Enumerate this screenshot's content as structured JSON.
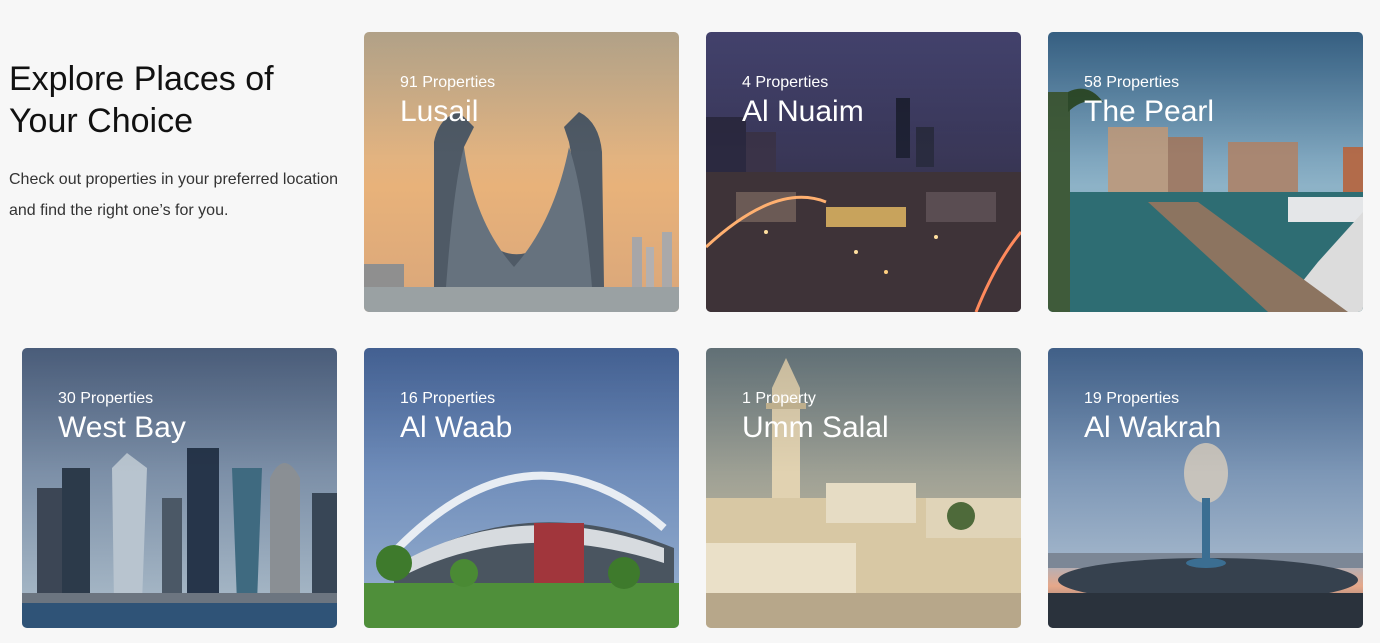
{
  "intro": {
    "title_line1": "Explore Places of",
    "title_line2": "Your Choice",
    "desc_line1": "Check out properties in your preferred location",
    "desc_line2": "and find the right one’s for you."
  },
  "places": [
    {
      "count": "91 Properties",
      "name": "Lusail"
    },
    {
      "count": "4 Properties",
      "name": "Al Nuaim"
    },
    {
      "count": "58 Properties",
      "name": "The Pearl"
    },
    {
      "count": "30 Properties",
      "name": "West Bay"
    },
    {
      "count": "16 Properties",
      "name": "Al Waab"
    },
    {
      "count": "1 Property",
      "name": "Umm Salal"
    },
    {
      "count": "19 Properties",
      "name": "Al Wakrah"
    }
  ]
}
